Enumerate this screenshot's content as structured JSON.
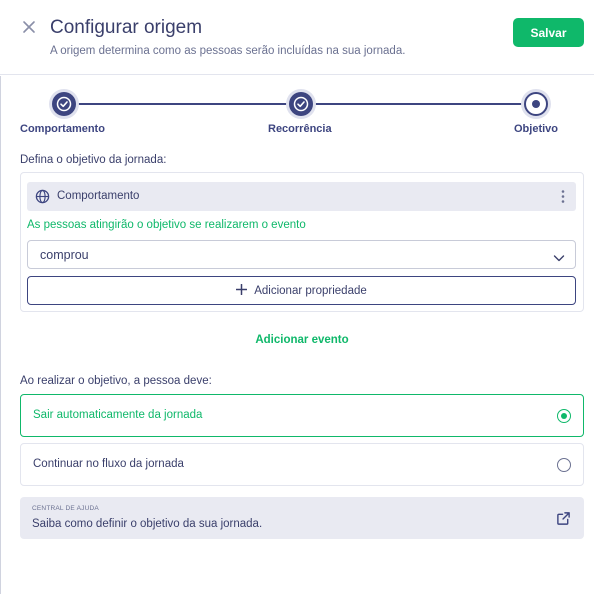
{
  "header": {
    "title": "Configurar origem",
    "subtitle": "A origem determina como as pessoas serão incluídas na sua jornada.",
    "save_label": "Salvar",
    "close_icon": "close-icon"
  },
  "stepper": {
    "steps": [
      {
        "label": "Comportamento",
        "state": "done"
      },
      {
        "label": "Recorrência",
        "state": "done"
      },
      {
        "label": "Objetivo",
        "state": "active"
      }
    ]
  },
  "goal": {
    "section_label": "Defina o objetivo da jornada:",
    "event_card": {
      "title": "Comportamento",
      "icon": "globe-icon",
      "menu_icon": "kebab-icon"
    },
    "condition_text": "As pessoas atingirão o objetivo se realizarem o evento",
    "event_select": {
      "value": "comprou"
    },
    "add_property_label": "Adicionar propriedade",
    "add_event_label": "Adicionar evento"
  },
  "behavior": {
    "section_label": "Ao realizar o objetivo, a pessoa deve:",
    "options": [
      {
        "label": "Sair automaticamente da jornada",
        "selected": true
      },
      {
        "label": "Continuar no fluxo da jornada",
        "selected": false
      }
    ]
  },
  "help": {
    "kicker": "CENTRAL DE AJUDA",
    "link_text": "Saiba como definir o objetivo da sua jornada.",
    "icon": "external-link-icon"
  },
  "colors": {
    "primary": "#3d4580",
    "accent_green": "#0fb86a",
    "text": "#3a3f6b",
    "muted": "#6b7191",
    "panel": "#e9eaf2"
  }
}
